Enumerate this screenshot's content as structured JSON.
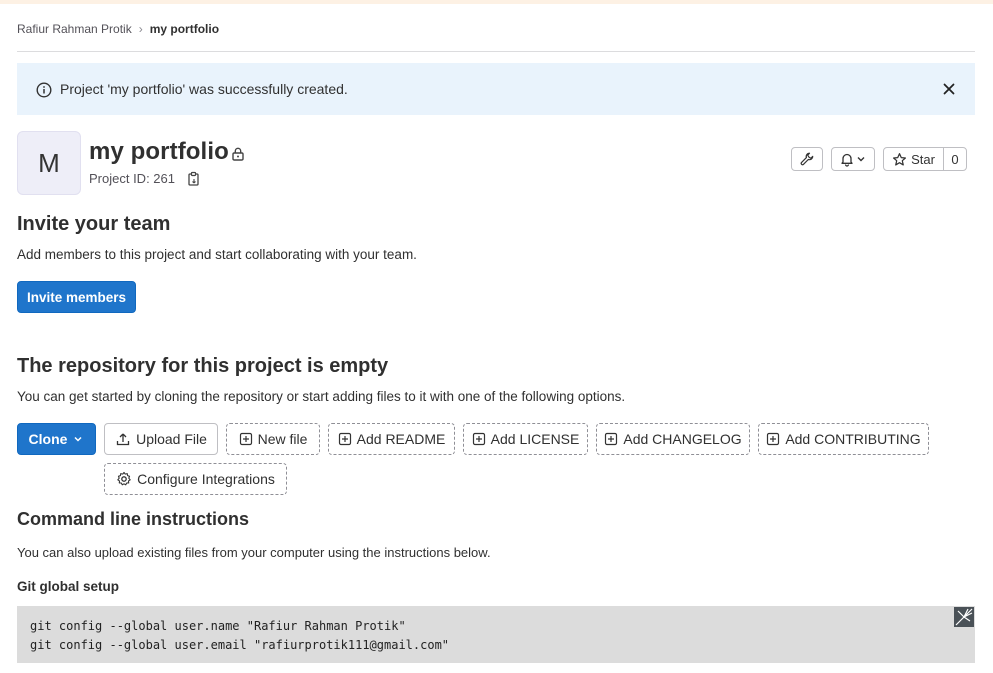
{
  "breadcrumb": {
    "parent": "Rafiur Rahman Protik",
    "current": "my portfolio"
  },
  "alert": {
    "message": "Project 'my portfolio' was successfully created."
  },
  "project": {
    "avatar_letter": "M",
    "title": "my portfolio",
    "id_text": "Project ID: 261"
  },
  "header_actions": {
    "star_label": "Star",
    "star_count": "0"
  },
  "invite": {
    "heading": "Invite your team",
    "description": "Add members to this project and start collaborating with your team.",
    "button_label": "Invite members"
  },
  "repo": {
    "heading": "The repository for this project is empty",
    "description": "You can get started by cloning the repository or start adding files to it with one of the following options.",
    "clone_label": "Clone",
    "actions": [
      {
        "label": "Upload File"
      },
      {
        "label": "New file"
      },
      {
        "label": "Add README"
      },
      {
        "label": "Add LICENSE"
      },
      {
        "label": "Add CHANGELOG"
      },
      {
        "label": "Add CONTRIBUTING"
      },
      {
        "label": "Configure Integrations"
      }
    ]
  },
  "cli": {
    "heading": "Command line instructions",
    "description": "You can also upload existing files from your computer using the instructions below.",
    "git_global_setup": "Git global setup",
    "code_lines": [
      "git config --global user.name \"Rafiur Rahman Protik\"",
      "git config --global user.email \"rafiurprotik111@gmail.com\""
    ]
  },
  "colors": {
    "primary": "#1f75cb",
    "alert_bg": "#e9f3fc",
    "code_bg": "#dcdcdc"
  },
  "icons": {
    "alert": "info-icon",
    "close": "close-icon",
    "visibility": "lock-icon",
    "copy": "clipboard-icon",
    "settings": "wrench-icon",
    "notifications": "bell-icon",
    "star": "star-icon",
    "upload": "upload-icon",
    "add": "plus-square-icon",
    "integrations": "gear-icon"
  }
}
